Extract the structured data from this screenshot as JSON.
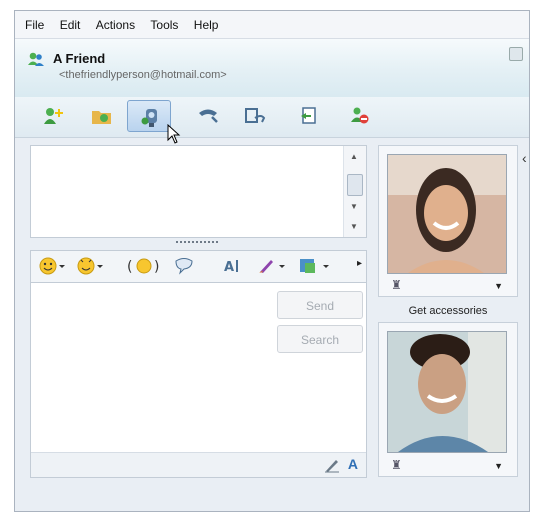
{
  "menu": {
    "items": [
      "File",
      "Edit",
      "Actions",
      "Tools",
      "Help"
    ]
  },
  "header": {
    "name": "A Friend",
    "email": "<thefriendlyperson@hotmail.com>"
  },
  "toolbar": {
    "buttons": [
      {
        "name": "invite-contact",
        "icon": "add-contact-icon"
      },
      {
        "name": "send-files",
        "icon": "folder-send-icon"
      },
      {
        "name": "webcam",
        "icon": "webcam-icon",
        "active": true
      },
      {
        "name": "call",
        "icon": "phone-icon"
      },
      {
        "name": "share",
        "icon": "share-window-icon"
      },
      {
        "name": "games",
        "icon": "activities-icon"
      },
      {
        "name": "block",
        "icon": "block-contact-icon"
      }
    ]
  },
  "compose": {
    "send_label": "Send",
    "search_label": "Search"
  },
  "format": {
    "font_icon_text": "A",
    "font_label": "A"
  },
  "right": {
    "accessories_label": "Get accessories"
  },
  "colors": {
    "accent": "#7ea5cf",
    "toolbar": "#dfeaf1",
    "disabled_text": "#a5abb2"
  }
}
